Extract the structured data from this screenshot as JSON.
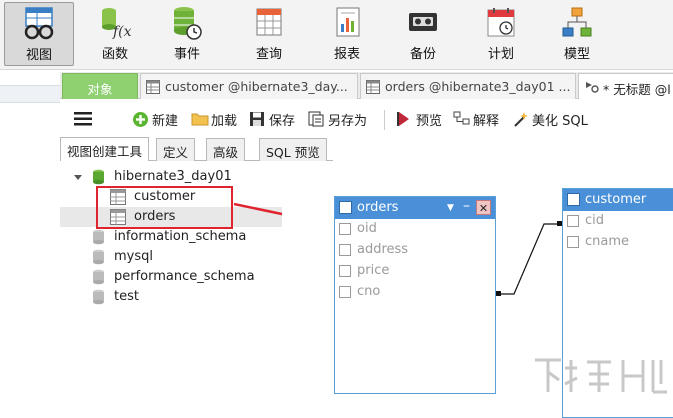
{
  "toolbar": {
    "buttons": [
      {
        "label": "视图",
        "icon": "view-glasses-icon"
      },
      {
        "label": "函数",
        "icon": "function-fx-icon"
      },
      {
        "label": "事件",
        "icon": "event-clock-icon"
      },
      {
        "label": "查询",
        "icon": "query-grid-icon"
      },
      {
        "label": "报表",
        "icon": "report-chart-icon"
      },
      {
        "label": "备份",
        "icon": "backup-tape-icon"
      },
      {
        "label": "计划",
        "icon": "schedule-calendar-icon"
      },
      {
        "label": "模型",
        "icon": "model-diagram-icon"
      }
    ]
  },
  "tabs": {
    "objects": "对象",
    "customer": "customer @hibernate3_day...",
    "orders": "orders @hibernate3_day01 ...",
    "untitled": "* 无标题 @l"
  },
  "view_toolbar": {
    "new": "新建",
    "load": "加载",
    "save": "保存",
    "save_as": "另存为",
    "preview": "预览",
    "explain": "解释",
    "beautify": "美化 SQL"
  },
  "subtabs": [
    "视图创建工具",
    "定义",
    "高级",
    "SQL 预览"
  ],
  "tree": {
    "database": "hibernate3_day01",
    "tables": [
      "customer",
      "orders"
    ],
    "other_databases": [
      "information_schema",
      "mysql",
      "performance_schema",
      "test"
    ]
  },
  "entities": {
    "orders": {
      "name": "orders",
      "fields": [
        "oid",
        "address",
        "price",
        "cno"
      ]
    },
    "customer": {
      "name": "customer",
      "fields": [
        "cid",
        "cname"
      ]
    }
  },
  "colors": {
    "accent": "#4a90d9",
    "objects_tab": "#8fd070",
    "highlight": "#e0242f"
  }
}
